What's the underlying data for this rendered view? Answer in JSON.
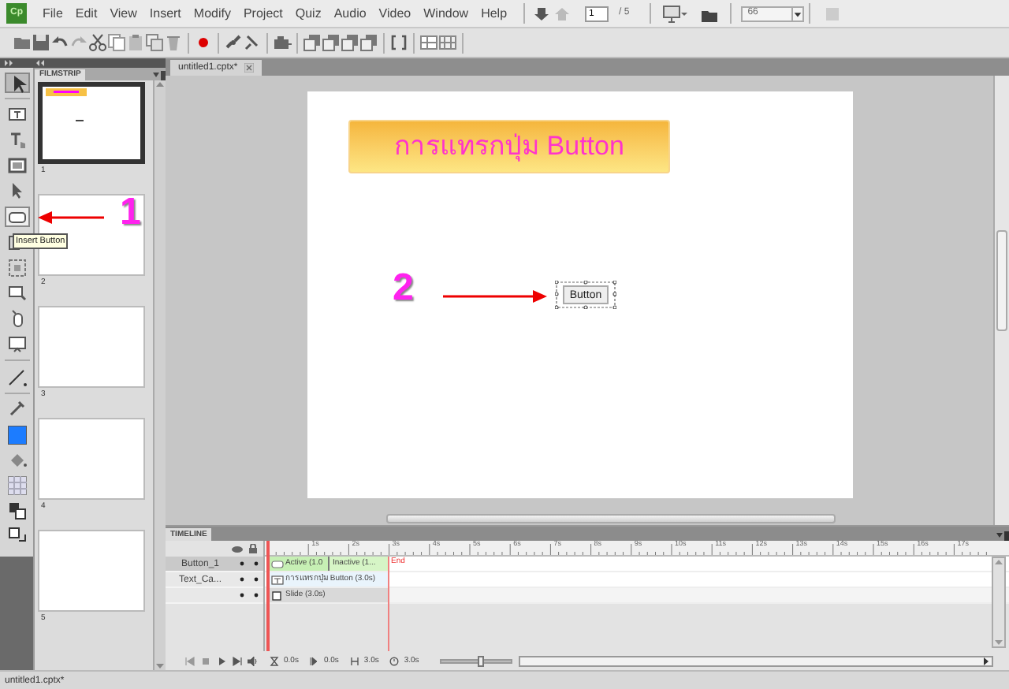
{
  "app": {
    "logo": "Cp"
  },
  "menu": [
    "File",
    "Edit",
    "View",
    "Insert",
    "Modify",
    "Project",
    "Quiz",
    "Audio",
    "Video",
    "Window",
    "Help"
  ],
  "toolbar": {
    "page": "1",
    "page_total": "/ 5",
    "zoom": "66"
  },
  "document_tab": {
    "title": "untitled1.cptx*"
  },
  "filmstrip": {
    "title": "FILMSTRIP",
    "slides": [
      {
        "number": "1",
        "selected": true,
        "kind": "content"
      },
      {
        "number": "2",
        "selected": false,
        "kind": "blank"
      },
      {
        "number": "3",
        "selected": false,
        "kind": "blank"
      },
      {
        "number": "4",
        "selected": false,
        "kind": "blank"
      },
      {
        "number": "5",
        "selected": false,
        "kind": "blank"
      }
    ]
  },
  "tooltip": "Insert Button",
  "callouts": [
    {
      "number": "1"
    },
    {
      "number": "2"
    }
  ],
  "slide": {
    "title": "การแทรกปุ่ม Button",
    "button": {
      "label": "Button",
      "selected": true
    }
  },
  "timeline": {
    "title": "TIMELINE",
    "ruler": [
      "1s",
      "2s",
      "3s",
      "4s",
      "5s",
      "6s",
      "7s",
      "8s",
      "9s",
      "10s",
      "11s",
      "12s",
      "13s",
      "14s",
      "15s",
      "16s",
      "17s"
    ],
    "end_marker": "End",
    "layers": [
      {
        "name": "Button_1",
        "selected": true,
        "bars": [
          {
            "label": "Active (1.0",
            "kind": "active"
          },
          {
            "label": "Inactive (1...",
            "kind": "inactive"
          }
        ]
      },
      {
        "name": "Text_Ca...",
        "selected": false,
        "bars": [
          {
            "label": "การแทรกปุ่ม Button (3.0s)",
            "kind": "caption"
          }
        ]
      },
      {
        "selected": false,
        "bars": [
          {
            "label": "Slide (3.0s)",
            "kind": "slide"
          }
        ]
      }
    ],
    "controls": [
      "0.0s",
      "0.0s",
      "3.0s",
      "3.0s"
    ],
    "zoom_slider": {
      "level": 0.55
    }
  },
  "status_bar": "untitled1.cptx*"
}
